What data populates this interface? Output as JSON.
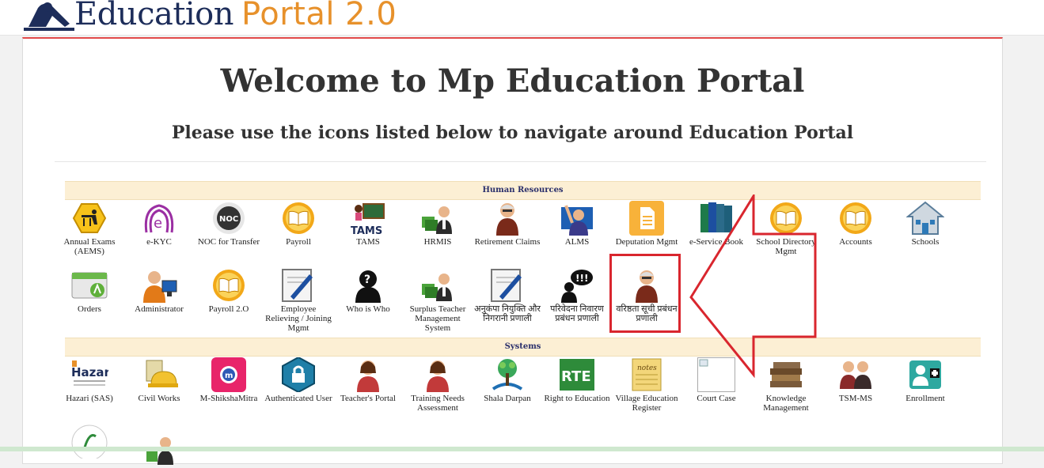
{
  "header": {
    "logo_text_1": "Education",
    "logo_text_2": "Portal 2.0"
  },
  "main": {
    "title": "Welcome to Mp Education Portal",
    "subtitle": "Please use the icons listed below to navigate around Education Portal"
  },
  "sections": {
    "hr": "Human Resources",
    "systems": "Systems"
  },
  "hr_row1": [
    {
      "label": "Annual Exams (AEMS)",
      "icon": "exam-icon"
    },
    {
      "label": "e-KYC",
      "icon": "fingerprint-icon"
    },
    {
      "label": "NOC for Transfer",
      "icon": "noc-icon"
    },
    {
      "label": "Payroll",
      "icon": "book-icon"
    },
    {
      "label": "TAMS",
      "icon": "tams-icon"
    },
    {
      "label": "HRMIS",
      "icon": "person-cube-icon"
    },
    {
      "label": "Retirement Claims",
      "icon": "elder-person-icon"
    },
    {
      "label": "ALMS",
      "icon": "person-raising-hand-icon"
    },
    {
      "label": "Deputation Mgmt",
      "icon": "document-icon"
    },
    {
      "label": "e-Service Book",
      "icon": "books-icon"
    },
    {
      "label": "School Directory Mgmt",
      "icon": "book-icon"
    },
    {
      "label": "Accounts",
      "icon": "book-icon"
    },
    {
      "label": "Schools",
      "icon": "house-icon"
    }
  ],
  "hr_row2": [
    {
      "label": "Orders",
      "icon": "orders-icon"
    },
    {
      "label": "Administrator",
      "icon": "admin-computer-icon"
    },
    {
      "label": "Payroll 2.O",
      "icon": "book-icon"
    },
    {
      "label": "Employee Relieving / Joining Mgmt",
      "icon": "pen-sign-icon"
    },
    {
      "label": "Who is Who",
      "icon": "silhouette-question-icon"
    },
    {
      "label": "Surplus Teacher Management System",
      "icon": "person-cube-icon"
    },
    {
      "label": "अनुकंपा नियुक्ति और निगरानी प्रणाली",
      "icon": "pen-sign-icon"
    },
    {
      "label": "परिवेदना निवारण प्रबंधन प्रणाली",
      "icon": "speech-alert-icon"
    },
    {
      "label": "वरिष्ठता सूची प्रबंधन प्रणाली",
      "icon": "elder-person-icon"
    }
  ],
  "sys_row1": [
    {
      "label": "Hazari (SAS)",
      "icon": "hazari-icon"
    },
    {
      "label": "Civil Works",
      "icon": "hardhat-icon"
    },
    {
      "label": "M-ShikshaMitra",
      "icon": "mshiksha-icon"
    },
    {
      "label": "Authenticated User",
      "icon": "lock-icon"
    },
    {
      "label": "Teacher's Portal",
      "icon": "teacher-icon"
    },
    {
      "label": "Training Needs Assessment",
      "icon": "teacher-icon"
    },
    {
      "label": "Shala Darpan",
      "icon": "shala-darpan-icon"
    },
    {
      "label": "Right to Education",
      "icon": "rte-icon"
    },
    {
      "label": "Village Education Register",
      "icon": "notes-icon"
    },
    {
      "label": "Court Case",
      "icon": "broken-image-icon"
    },
    {
      "label": "Knowledge Management",
      "icon": "book-stack-icon"
    },
    {
      "label": "TSM-MS",
      "icon": "two-people-icon"
    },
    {
      "label": "Enrollment",
      "icon": "enrollment-icon"
    }
  ],
  "logo_icon": "education-portal-logo-icon"
}
